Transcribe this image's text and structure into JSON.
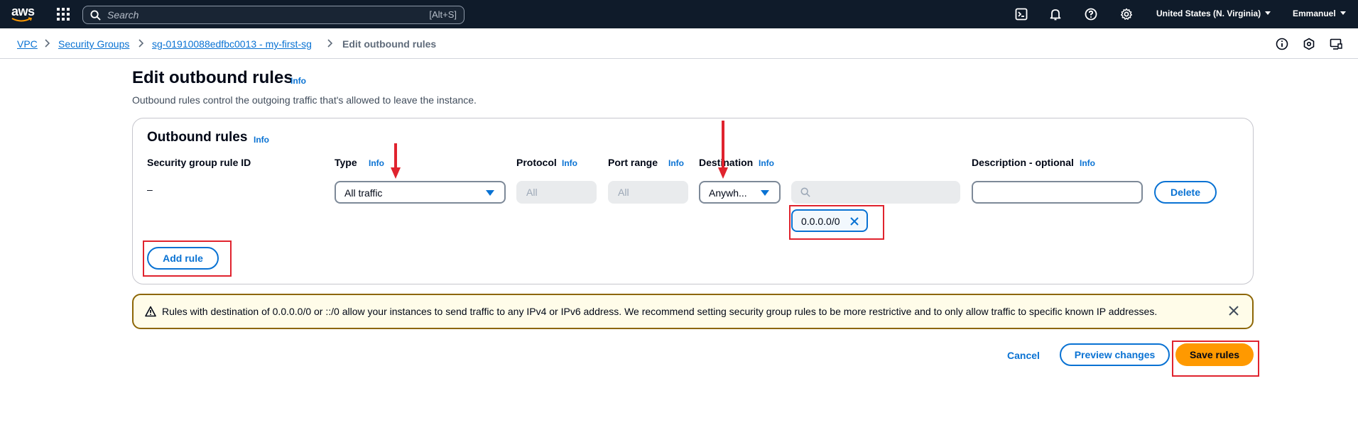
{
  "topnav": {
    "logo_text": "aws",
    "search_placeholder": "Search",
    "search_shortcut": "[Alt+S]",
    "region": "United States (N. Virginia)",
    "user": "Emmanuel",
    "icons": [
      "cloudshell-icon",
      "bell-icon",
      "help-icon",
      "gear-icon"
    ]
  },
  "breadcrumb": {
    "items": [
      "VPC",
      "Security Groups",
      "sg-01910088edfbc0013 - my-first-sg"
    ],
    "current": "Edit outbound rules"
  },
  "page": {
    "title": "Edit outbound rules",
    "info": "Info",
    "description": "Outbound rules control the outgoing traffic that's allowed to leave the instance."
  },
  "container": {
    "title": "Outbound rules",
    "info": "Info",
    "columns": {
      "rule_id": "Security group rule ID",
      "type": "Type",
      "protocol": "Protocol",
      "port_range": "Port range",
      "destination": "Destination",
      "description": "Description - optional"
    },
    "rule": {
      "rule_id": "–",
      "type": "All traffic",
      "protocol": "All",
      "port_range": "All",
      "destination": "Anywh...",
      "cidr_token": "0.0.0.0/0",
      "delete_label": "Delete"
    },
    "add_rule_label": "Add rule"
  },
  "alert": {
    "text": "Rules with destination of 0.0.0.0/0 or ::/0 allow your instances to send traffic to any IPv4 or IPv6 address. We recommend setting security group rules to be more restrictive and to only allow traffic to specific known IP addresses."
  },
  "footer": {
    "cancel": "Cancel",
    "preview": "Preview changes",
    "save": "Save rules"
  },
  "colors": {
    "nav_bg": "#0f1b2a",
    "link": "#0972d3",
    "primary_button": "#ff9900",
    "annotation_red": "#e0232e",
    "warning_border": "#8d6605"
  }
}
